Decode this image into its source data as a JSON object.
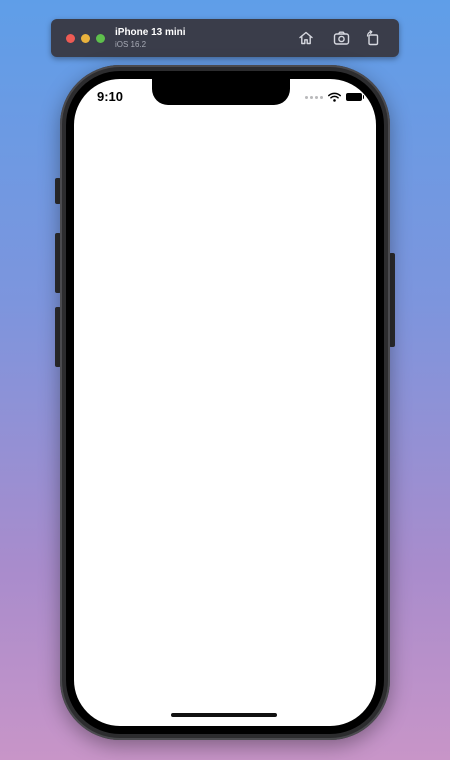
{
  "simulator": {
    "device_name": "iPhone 13 mini",
    "os_version": "iOS 16.2",
    "toolbar": {
      "home_icon": "home-icon",
      "screenshot_icon": "camera-icon",
      "rotate_icon": "rotate-icon"
    }
  },
  "status_bar": {
    "time": "9:10"
  },
  "colors": {
    "background_top": "#5f9ee8",
    "background_bottom": "#c895c8",
    "toolbar": "#3a3d4a",
    "screen": "#ffffff"
  }
}
